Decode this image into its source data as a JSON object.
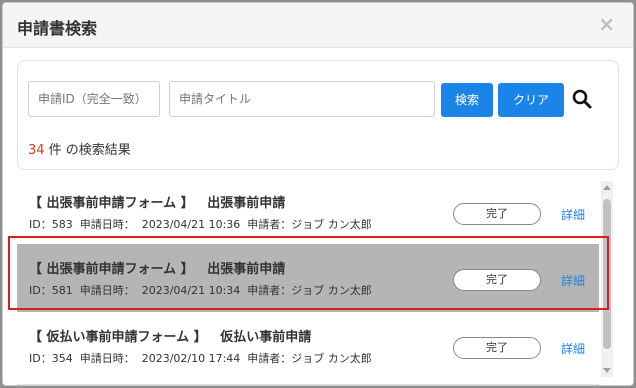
{
  "dialog": {
    "title": "申請書検索",
    "close_label": "×"
  },
  "search": {
    "id_placeholder": "申請ID（完全一致）",
    "title_placeholder": "申請タイトル",
    "search_button": "検索",
    "clear_button": "クリア",
    "result_count": "34",
    "result_suffix": " 件 の検索結果"
  },
  "results": [
    {
      "title": "【 出張事前申請フォーム 】   出張事前申請",
      "meta": "ID：583  申請日時：  2023/04/21 10:36  申請者：ジョブ カン太郎",
      "status": "完了",
      "detail": "詳細"
    },
    {
      "title": "【 出張事前申請フォーム 】   出張事前申請",
      "meta": "ID：581  申請日時：  2023/04/21 10:34  申請者：ジョブ カン太郎",
      "status": "完了",
      "detail": "詳細"
    },
    {
      "title": "【 仮払い事前申請フォーム 】   仮払い事前申請",
      "meta": "ID：354  申請日時：  2023/02/10 17:44  申請者：ジョブ カン太郎",
      "status": "完了",
      "detail": "詳細"
    }
  ],
  "colors": {
    "accent": "#1a84e8",
    "count": "#d93a1a",
    "highlight_border": "#d81e1e",
    "selected_row": "#b5b5b5"
  },
  "icons": {
    "search": "search-icon",
    "close": "close-icon"
  }
}
